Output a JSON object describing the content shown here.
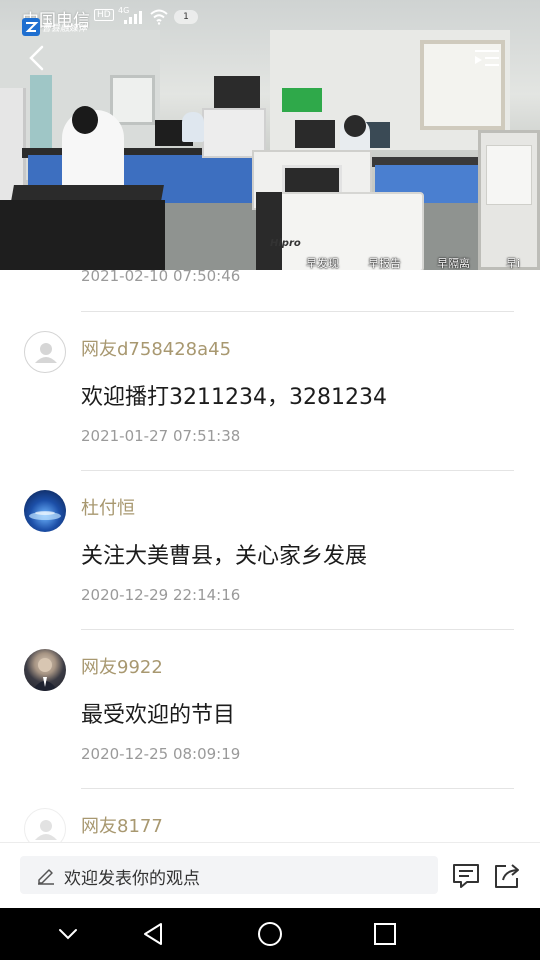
{
  "status_bar": {
    "carrier": "中国电信",
    "hd": "HD",
    "network": "4G",
    "notification_count": "1",
    "app_badge": "曹县融媒体"
  },
  "video": {
    "device_brand": "Hipro",
    "captions": [
      "早发现",
      "早报告",
      "早隔离",
      "早i"
    ]
  },
  "previous_comment_time": "2021-02-10 07:50:46",
  "comments": [
    {
      "user": "网友d758428a45",
      "text": "欢迎播打3211234，3281234",
      "time": "2021-01-27 07:51:38",
      "avatar": "default"
    },
    {
      "user": "杜付恒",
      "text": "关注大美曹县，关心家乡发展",
      "time": "2020-12-29 22:14:16",
      "avatar": "blue"
    },
    {
      "user": "网友9922",
      "text": "最受欢迎的节目",
      "time": "2020-12-25 08:09:19",
      "avatar": "photo"
    },
    {
      "user": "网友8177",
      "text": "",
      "time": "",
      "avatar": "default"
    }
  ],
  "input_bar": {
    "placeholder": "欢迎发表你的观点"
  },
  "icons": {
    "back": "chevron-left-icon",
    "menu": "playlist-menu-icon",
    "comments": "comment-icon",
    "share": "share-icon",
    "pen": "pencil-icon"
  },
  "colors": {
    "username": "#a89870",
    "timestamp": "#9a9a9a",
    "text": "#1c1c1c",
    "input_bg": "#f3f4f6"
  }
}
